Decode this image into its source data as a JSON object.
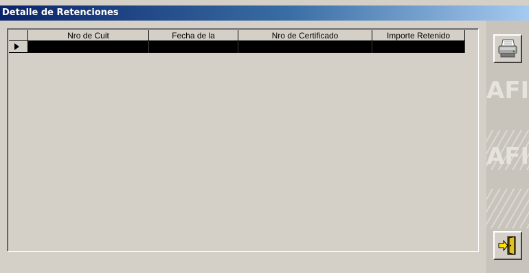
{
  "window": {
    "title": "Detalle de Retenciones"
  },
  "grid": {
    "columns": [
      "Nro de Cuit",
      "Fecha de la",
      "Nro de Certificado",
      "Importe Retenido"
    ],
    "rows": [
      [
        "",
        "",
        "",
        ""
      ]
    ]
  },
  "side_panel": {
    "watermark": "AFIP"
  },
  "buttons": [
    {
      "name": "print-button",
      "icon": "printer-icon"
    },
    {
      "name": "exit-button",
      "icon": "exit-door-icon"
    }
  ],
  "colors": {
    "titlebar_start": "#0a246a",
    "titlebar_end": "#a6caf0",
    "row_selected": "#000000",
    "panel": "#d4d0c8"
  }
}
